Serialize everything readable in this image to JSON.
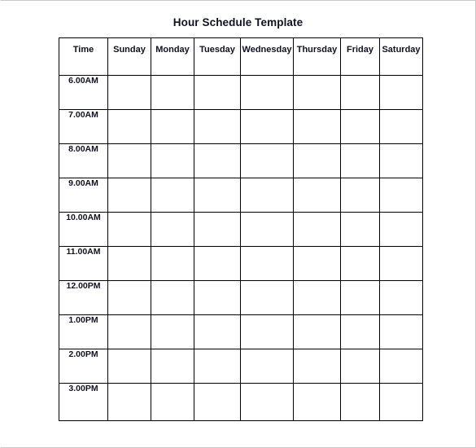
{
  "document": {
    "title": "Hour Schedule Template"
  },
  "colors": {
    "text": "#111122",
    "grid_line": "#000000",
    "page_border": "#c8c8c8",
    "background": "#ffffff"
  },
  "table": {
    "columns": [
      {
        "key": "time",
        "label": "Time"
      },
      {
        "key": "sunday",
        "label": "Sunday"
      },
      {
        "key": "monday",
        "label": "Monday"
      },
      {
        "key": "tuesday",
        "label": "Tuesday"
      },
      {
        "key": "wednesday",
        "label": "Wednesday"
      },
      {
        "key": "thursday",
        "label": "Thursday"
      },
      {
        "key": "friday",
        "label": "Friday"
      },
      {
        "key": "saturday",
        "label": "Saturday"
      }
    ],
    "rows": [
      {
        "time": "6.00AM",
        "sunday": "",
        "monday": "",
        "tuesday": "",
        "wednesday": "",
        "thursday": "",
        "friday": "",
        "saturday": ""
      },
      {
        "time": "7.00AM",
        "sunday": "",
        "monday": "",
        "tuesday": "",
        "wednesday": "",
        "thursday": "",
        "friday": "",
        "saturday": ""
      },
      {
        "time": "8.00AM",
        "sunday": "",
        "monday": "",
        "tuesday": "",
        "wednesday": "",
        "thursday": "",
        "friday": "",
        "saturday": ""
      },
      {
        "time": "9.00AM",
        "sunday": "",
        "monday": "",
        "tuesday": "",
        "wednesday": "",
        "thursday": "",
        "friday": "",
        "saturday": ""
      },
      {
        "time": "10.00AM",
        "sunday": "",
        "monday": "",
        "tuesday": "",
        "wednesday": "",
        "thursday": "",
        "friday": "",
        "saturday": ""
      },
      {
        "time": "11.00AM",
        "sunday": "",
        "monday": "",
        "tuesday": "",
        "wednesday": "",
        "thursday": "",
        "friday": "",
        "saturday": ""
      },
      {
        "time": "12.00PM",
        "sunday": "",
        "monday": "",
        "tuesday": "",
        "wednesday": "",
        "thursday": "",
        "friday": "",
        "saturday": ""
      },
      {
        "time": "1.00PM",
        "sunday": "",
        "monday": "",
        "tuesday": "",
        "wednesday": "",
        "thursday": "",
        "friday": "",
        "saturday": ""
      },
      {
        "time": "2.00PM",
        "sunday": "",
        "monday": "",
        "tuesday": "",
        "wednesday": "",
        "thursday": "",
        "friday": "",
        "saturday": ""
      },
      {
        "time": "3.00PM",
        "sunday": "",
        "monday": "",
        "tuesday": "",
        "wednesday": "",
        "thursday": "",
        "friday": "",
        "saturday": ""
      }
    ]
  }
}
